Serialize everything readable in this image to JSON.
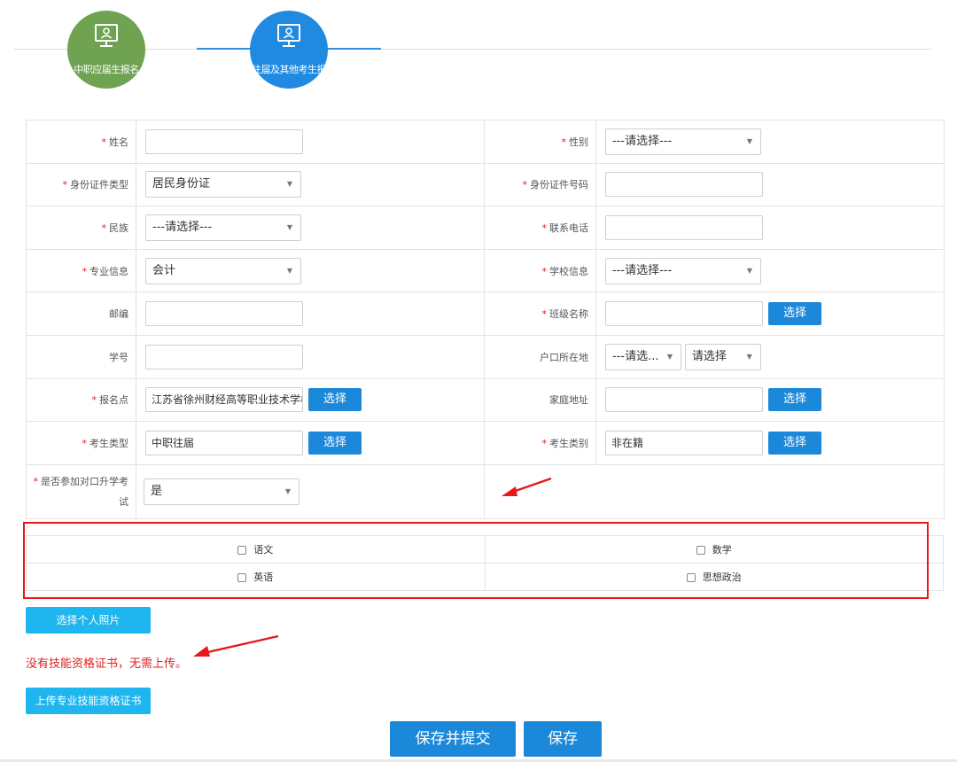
{
  "steps": [
    {
      "label": "中职应届生报名",
      "icon": "monitor-user-icon",
      "color": "#6fa251"
    },
    {
      "label": "往届及其他考生报",
      "icon": "monitor-user-icon",
      "color": "#1f8ae0"
    }
  ],
  "form": {
    "name": {
      "label": "姓名",
      "value": ""
    },
    "gender": {
      "label": "性别",
      "value": "---请选择---"
    },
    "id_type": {
      "label": "身份证件类型",
      "value": "居民身份证"
    },
    "id_number": {
      "label": "身份证件号码",
      "value": ""
    },
    "ethnicity": {
      "label": "民族",
      "value": "---请选择---"
    },
    "phone": {
      "label": "联系电话",
      "value": ""
    },
    "major": {
      "label": "专业信息",
      "value": "会计"
    },
    "school": {
      "label": "学校信息",
      "value": "---请选择---"
    },
    "postcode": {
      "label": "邮编",
      "value": ""
    },
    "class_name": {
      "label": "班级名称",
      "value": "",
      "button": "选择"
    },
    "student_no": {
      "label": "学号",
      "value": ""
    },
    "hukou": {
      "label": "户口所在地",
      "value1": "---请选...",
      "value2": "请选择"
    },
    "site": {
      "label": "报名点",
      "value": "江苏省徐州财经高等职业技术学校",
      "button": "选择"
    },
    "address": {
      "label": "家庭地址",
      "value": "",
      "button": "选择"
    },
    "exam_type": {
      "label": "考生类型",
      "value": "中职往届",
      "button": "选择"
    },
    "exam_category": {
      "label": "考生类别",
      "value": "非在籍",
      "button": "选择"
    },
    "duikou": {
      "label1": "是否参加对口升学考",
      "label2": "试",
      "value": "是"
    }
  },
  "subjects": [
    "语文",
    "数学",
    "英语",
    "思想政治"
  ],
  "photo_button": "选择个人照片",
  "note": "没有技能资格证书，无需上传。",
  "upload_button": "上传专业技能资格证书",
  "save_submit": "保存并提交",
  "save": "保存",
  "required_mark": "*",
  "colors": {
    "accent": "#1c88d9",
    "cyan": "#1fb6ef",
    "required": "#e02020",
    "highlight": "#e8181a"
  }
}
